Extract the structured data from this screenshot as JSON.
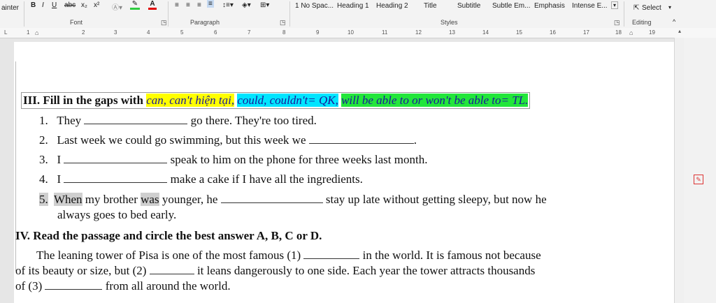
{
  "ribbon": {
    "clipboard_label": "ainter",
    "font_buttons": [
      "B",
      "I",
      "U",
      "abc",
      "x₂",
      "x²"
    ],
    "font_group": "Font",
    "paragraph_group": "Paragraph",
    "styles": [
      "1 No Spac...",
      "Heading 1",
      "Heading 2",
      "Title",
      "Subtitle",
      "Subtle Em...",
      "Emphasis",
      "Intense E..."
    ],
    "styles_group": "Styles",
    "select_label": "Select",
    "editing_group": "Editing"
  },
  "ruler": {
    "ticks": [
      "1",
      "2",
      "3",
      "4",
      "5",
      "6",
      "7",
      "8",
      "9",
      "10",
      "11",
      "12",
      "13",
      "14",
      "15",
      "16",
      "17",
      "18",
      "19"
    ]
  },
  "doc": {
    "section3": {
      "title": "III. Fill in the gaps with",
      "hl1": "can, can't hiện tại,",
      "hl2": "could, couldn't= QK,",
      "hl3": "will be able to or won't be able to= TL."
    },
    "items": [
      {
        "num": "1.",
        "a": "They",
        "b": "go there. They're too tired."
      },
      {
        "num": "2.",
        "a": "Last week we could go swimming, but this week we",
        "b": "."
      },
      {
        "num": "3.",
        "a": "I",
        "b": "speak to him on the phone for three weeks last month."
      },
      {
        "num": "4.",
        "a": "I",
        "b": "make a cake if I have all the ingredients."
      },
      {
        "num": "5.",
        "a1": "When",
        "a2": "my brother",
        "a3": "was",
        "a4": "younger, he",
        "b": "stay up late without getting sleepy, but now he",
        "c": "always goes to bed early."
      }
    ],
    "section4": {
      "title": "IV. Read the passage and circle the best answer A, B, C or D.",
      "p1a": "The leaning tower of Pisa is one of the most famous (1)",
      "p1b": "in the world. It is famous not because",
      "p2a": "of its beauty or size, but (2)",
      "p2b": "it leans dangerously to one side. Each year the tower attracts thousands",
      "p3a": "of (3)",
      "p3b": "from all around the world."
    }
  }
}
